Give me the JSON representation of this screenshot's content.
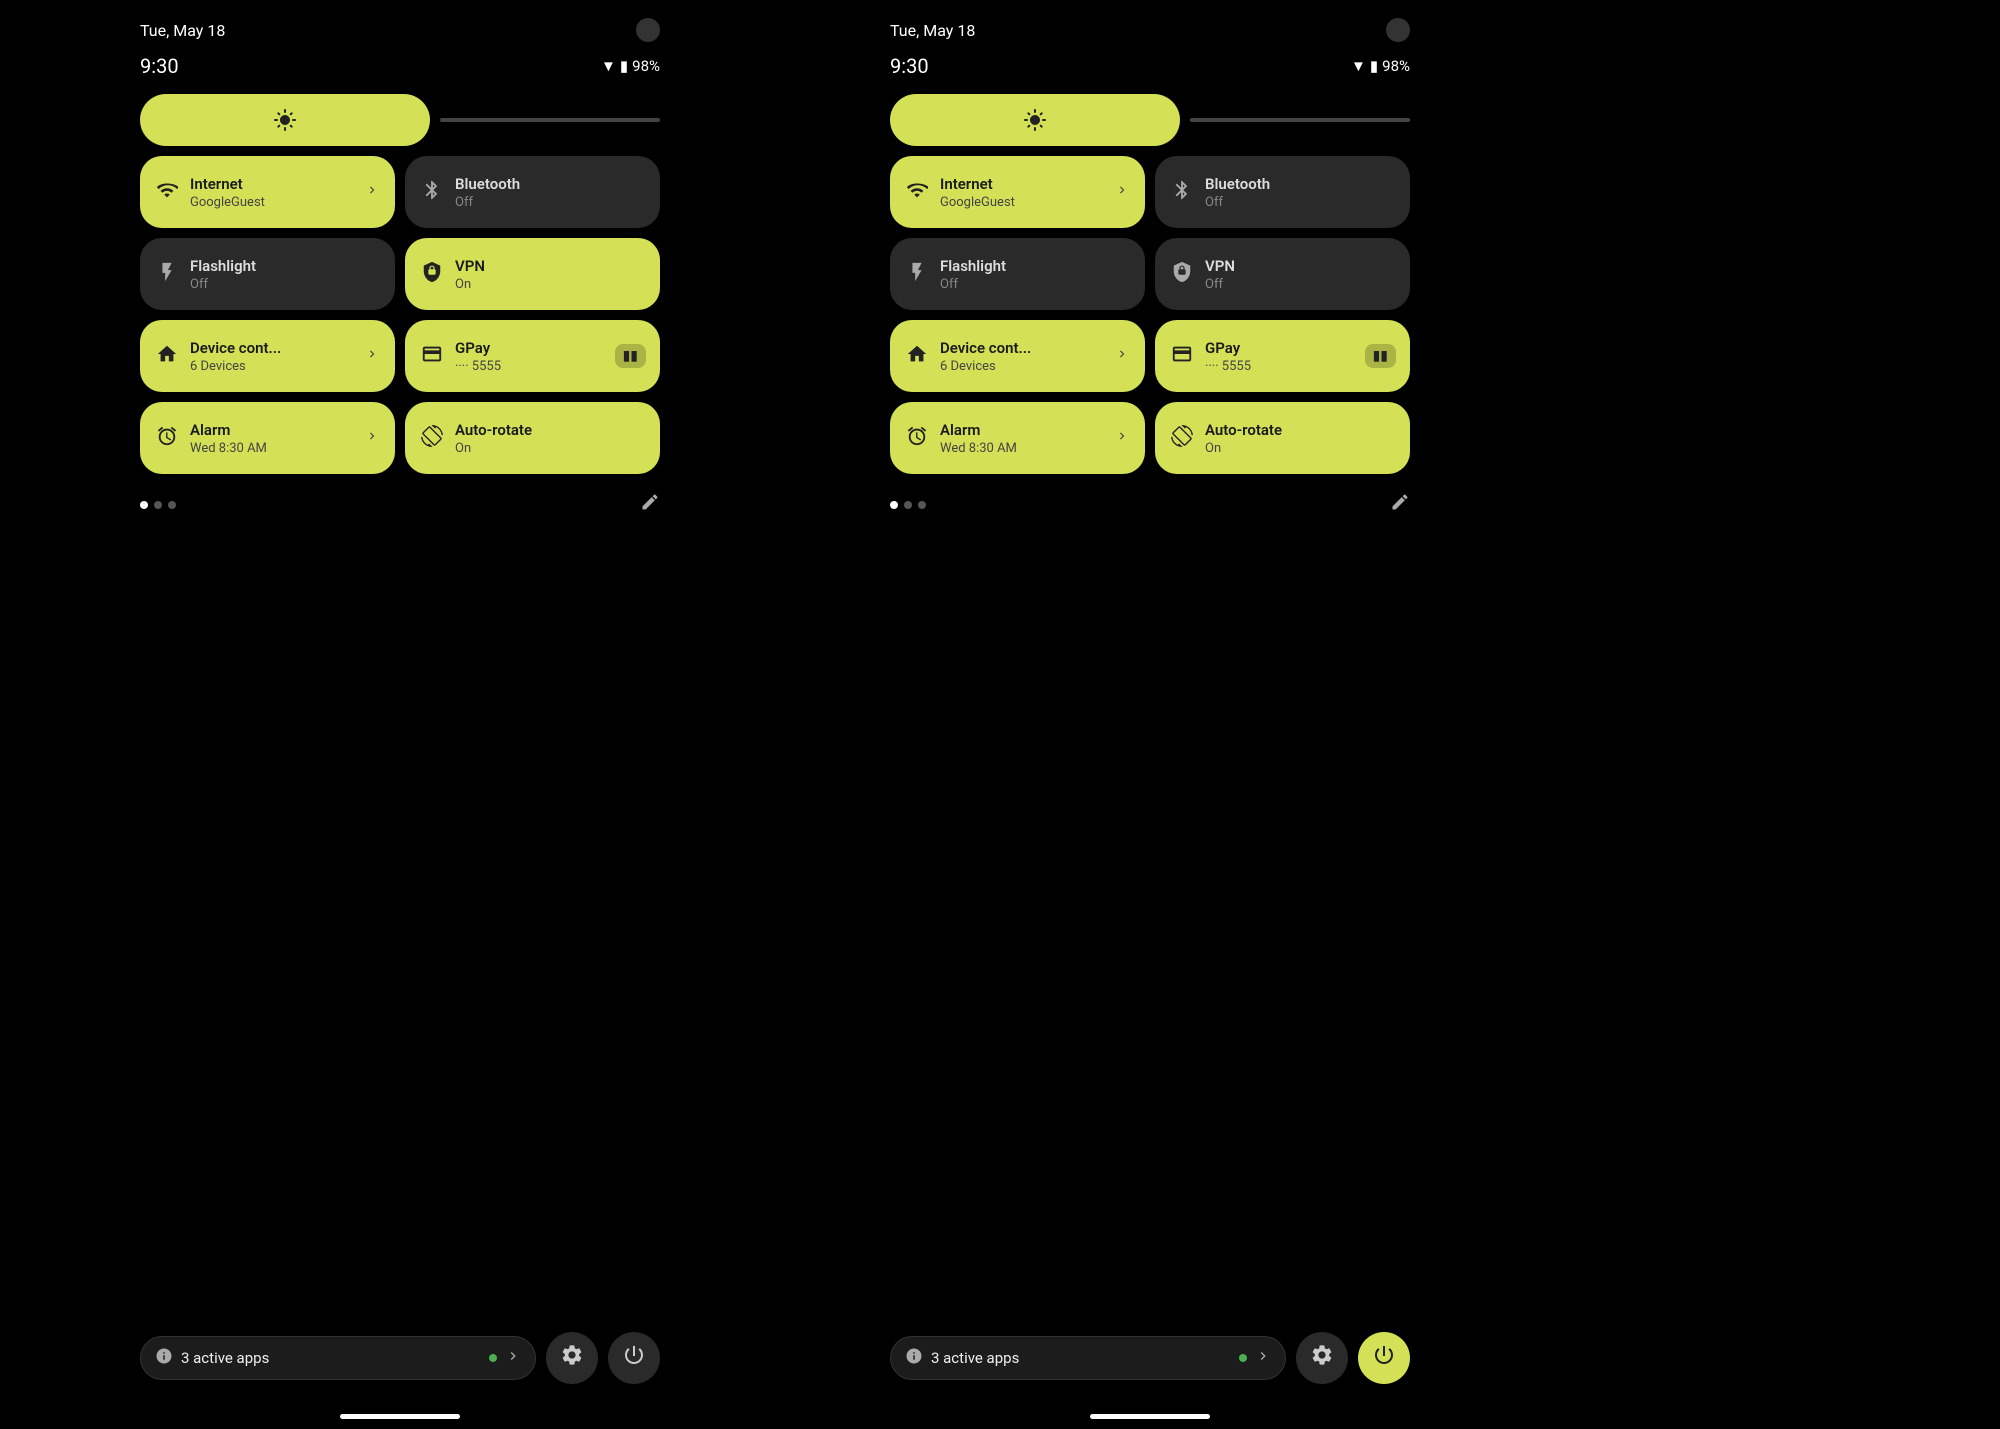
{
  "panels": [
    {
      "id": "left",
      "date": "Tue, May 18",
      "time": "9:30",
      "battery": "98%",
      "brightness": {},
      "tiles": [
        {
          "id": "internet",
          "icon": "wifi",
          "title": "Internet",
          "subtitle": "GoogleGuest",
          "state": "active",
          "hasChevron": true
        },
        {
          "id": "bluetooth",
          "icon": "bluetooth",
          "title": "Bluetooth",
          "subtitle": "Off",
          "state": "inactive",
          "hasChevron": false
        },
        {
          "id": "flashlight",
          "icon": "flashlight",
          "title": "Flashlight",
          "subtitle": "Off",
          "state": "inactive",
          "hasChevron": false
        },
        {
          "id": "vpn",
          "icon": "vpn",
          "title": "VPN",
          "subtitle": "On",
          "state": "active",
          "hasChevron": false
        },
        {
          "id": "device",
          "icon": "device",
          "title": "Device cont...",
          "subtitle": "6 Devices",
          "state": "active",
          "hasChevron": true
        },
        {
          "id": "gpay",
          "icon": "gpay",
          "title": "GPay",
          "subtitle": "···· 5555",
          "state": "active",
          "hasChevron": false,
          "hasBadge": true
        },
        {
          "id": "alarm",
          "icon": "alarm",
          "title": "Alarm",
          "subtitle": "Wed 8:30 AM",
          "state": "active",
          "hasChevron": true
        },
        {
          "id": "autorotate",
          "icon": "autorotate",
          "title": "Auto-rotate",
          "subtitle": "On",
          "state": "active",
          "hasChevron": false
        }
      ],
      "activeApps": "3 active apps",
      "powerBtnActive": false
    },
    {
      "id": "right",
      "date": "Tue, May 18",
      "time": "9:30",
      "battery": "98%",
      "brightness": {},
      "tiles": [
        {
          "id": "internet",
          "icon": "wifi",
          "title": "Internet",
          "subtitle": "GoogleGuest",
          "state": "active",
          "hasChevron": true
        },
        {
          "id": "bluetooth",
          "icon": "bluetooth",
          "title": "Bluetooth",
          "subtitle": "Off",
          "state": "inactive",
          "hasChevron": false
        },
        {
          "id": "flashlight",
          "icon": "flashlight",
          "title": "Flashlight",
          "subtitle": "Off",
          "state": "inactive",
          "hasChevron": false
        },
        {
          "id": "vpn",
          "icon": "vpn",
          "title": "VPN",
          "subtitle": "Off",
          "state": "inactive",
          "hasChevron": false
        },
        {
          "id": "device",
          "icon": "device",
          "title": "Device cont...",
          "subtitle": "6 Devices",
          "state": "active",
          "hasChevron": true
        },
        {
          "id": "gpay",
          "icon": "gpay",
          "title": "GPay",
          "subtitle": "···· 5555",
          "state": "active",
          "hasChevron": false,
          "hasBadge": true
        },
        {
          "id": "alarm",
          "icon": "alarm",
          "title": "Alarm",
          "subtitle": "Wed 8:30 AM",
          "state": "active",
          "hasChevron": true
        },
        {
          "id": "autorotate",
          "icon": "autorotate",
          "title": "Auto-rotate",
          "subtitle": "On",
          "state": "active",
          "hasChevron": false
        }
      ],
      "activeApps": "3 active apps",
      "powerBtnActive": true
    }
  ],
  "colors": {
    "active_tile_bg": "#d4e157",
    "inactive_tile_bg": "#2a2a2a",
    "screen_bg": "#000000"
  }
}
